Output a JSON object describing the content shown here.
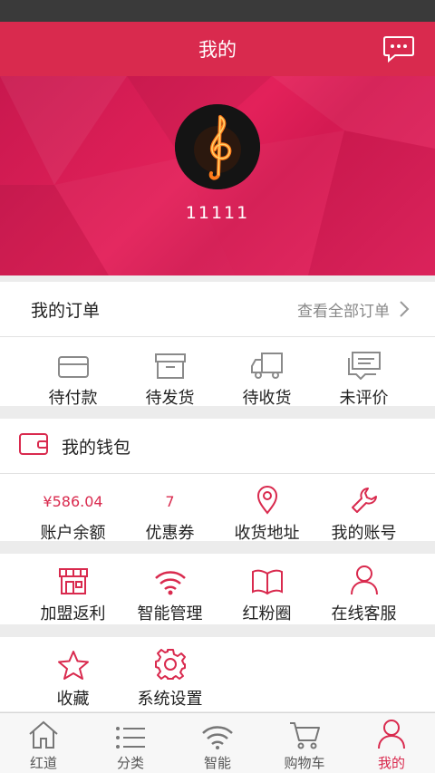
{
  "header": {
    "title": "我的",
    "message_icon": "chat-bubble-icon"
  },
  "profile": {
    "username": "11111",
    "avatar_icon": "treble-clef-avatar"
  },
  "orders": {
    "title": "我的订单",
    "view_all": "查看全部订单",
    "items": [
      {
        "label": "待付款",
        "icon": "card-icon"
      },
      {
        "label": "待发货",
        "icon": "box-icon"
      },
      {
        "label": "待收货",
        "icon": "truck-icon"
      },
      {
        "label": "未评价",
        "icon": "comment-icon"
      }
    ]
  },
  "wallet": {
    "title": "我的钱包",
    "items": [
      {
        "value": "¥586.04",
        "label": "账户余额"
      },
      {
        "value": "7",
        "label": "优惠券"
      },
      {
        "label": "收货地址",
        "icon": "location-pin-icon"
      },
      {
        "label": "我的账号",
        "icon": "wrench-icon"
      }
    ]
  },
  "services": {
    "items": [
      {
        "label": "加盟返利",
        "icon": "shop-icon"
      },
      {
        "label": "智能管理",
        "icon": "wifi-icon"
      },
      {
        "label": "红粉圈",
        "icon": "book-icon"
      },
      {
        "label": "在线客服",
        "icon": "person-icon"
      }
    ]
  },
  "extras": {
    "items": [
      {
        "label": "收藏",
        "icon": "star-icon"
      },
      {
        "label": "系统设置",
        "icon": "settings-gear-icon"
      }
    ]
  },
  "tabbar": {
    "tabs": [
      {
        "label": "红道",
        "icon": "home-icon"
      },
      {
        "label": "分类",
        "icon": "list-icon"
      },
      {
        "label": "智能",
        "icon": "wifi-icon"
      },
      {
        "label": "购物车",
        "icon": "cart-icon"
      },
      {
        "label": "我的",
        "icon": "user-icon",
        "active": true
      }
    ]
  },
  "colors": {
    "accent": "#d92a4e",
    "gray_icon": "#8a8a8a",
    "banner": "#e3215a"
  }
}
